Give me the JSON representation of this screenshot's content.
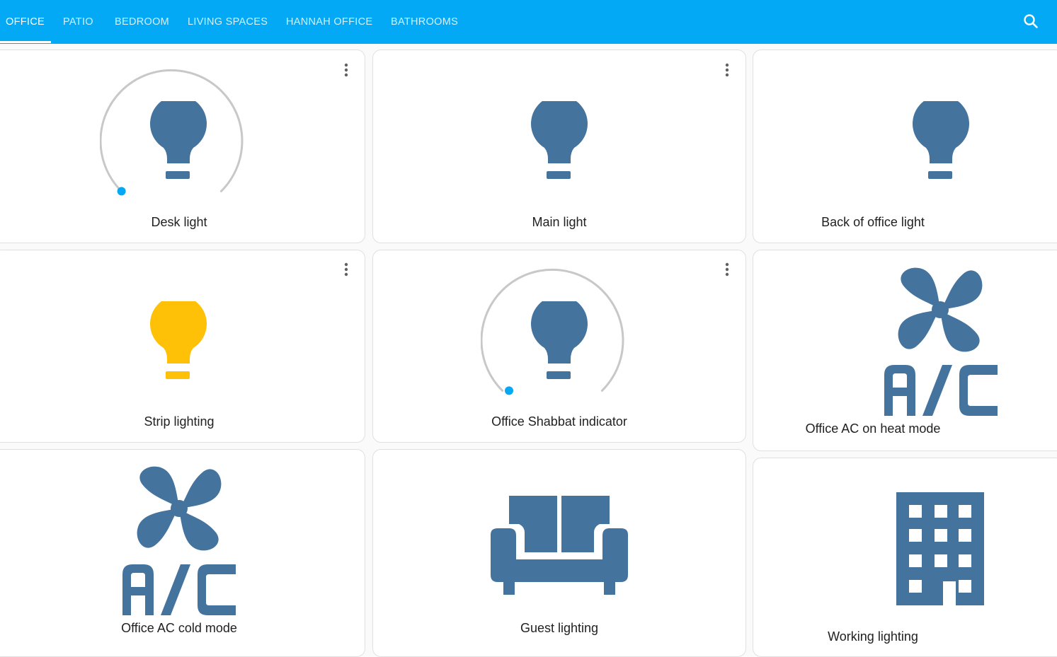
{
  "tabs": [
    {
      "label": "OFFICE",
      "active": true
    },
    {
      "label": "PATIO",
      "active": false
    },
    {
      "label": "BEDROOM",
      "active": false
    },
    {
      "label": "LIVING SPACES",
      "active": false
    },
    {
      "label": "HANNAH OFFICE",
      "active": false
    },
    {
      "label": "BATHROOMS",
      "active": false
    }
  ],
  "header": {
    "search_icon": "magnify-icon"
  },
  "colors": {
    "accent": "#03a9f4",
    "icon_off": "#44739e",
    "icon_on": "#ffc107",
    "slider_track": "#c8c8c8"
  },
  "cards": {
    "desk_light": {
      "name": "Desk light",
      "icon": "lightbulb-icon",
      "state": "off",
      "brightness_slider": true,
      "brightness_value": 0
    },
    "main_light": {
      "name": "Main light",
      "icon": "lightbulb-icon",
      "state": "off"
    },
    "back_office_light": {
      "name": "Back of office light",
      "icon": "lightbulb-icon",
      "state": "off"
    },
    "strip_lighting": {
      "name": "Strip lighting",
      "icon": "lightbulb-icon",
      "state": "on"
    },
    "shabbat_indicator": {
      "name": "Office Shabbat indicator",
      "icon": "lightbulb-icon",
      "state": "off",
      "brightness_slider": true,
      "brightness_value": 0
    },
    "ac_heat_mode": {
      "name": "Office AC on heat mode",
      "icon": "air-conditioner-fan-icon"
    },
    "ac_cold_mode": {
      "name": "Office AC cold mode",
      "icon": "air-conditioner-fan-icon"
    },
    "guest_lighting": {
      "name": "Guest lighting",
      "icon": "sofa-icon"
    },
    "working_lighting": {
      "name": "Working lighting",
      "icon": "office-building-icon"
    }
  }
}
